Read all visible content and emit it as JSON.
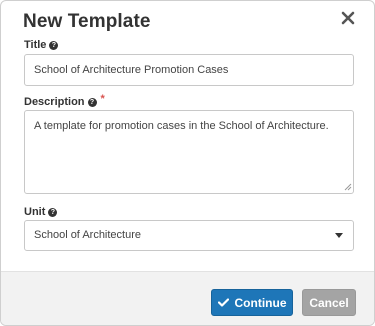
{
  "dialog": {
    "title": "New Template",
    "close_icon": "close-icon"
  },
  "form": {
    "title_label": "Title",
    "title_value": "School of Architecture Promotion Cases",
    "description_label": "Description",
    "required_mark": "*",
    "description_value": "A template for promotion cases in the School of Architecture.",
    "unit_label": "Unit",
    "unit_value": "School of Architecture",
    "help_icon": "question-circle-icon"
  },
  "footer": {
    "continue_label": "Continue",
    "continue_icon": "check-icon",
    "cancel_label": "Cancel"
  },
  "colors": {
    "primary": "#1e76b8",
    "secondary": "#a4a4a4",
    "required": "#d9534f"
  }
}
